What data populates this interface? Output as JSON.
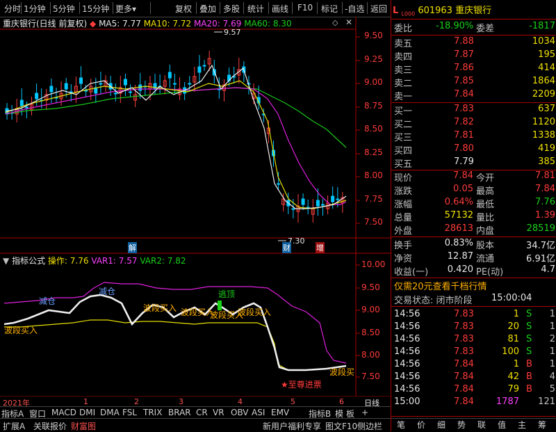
{
  "toolbar": {
    "items": [
      "分时",
      "1分钟",
      "5分钟",
      "15分钟",
      "更多",
      "复权",
      "叠加",
      "多股",
      "统计",
      "画线",
      "F10",
      "标记",
      "-自选",
      "返回"
    ]
  },
  "chart_header": {
    "title": "重庆银行(日线 前复权)",
    "ma5_label": "MA5: 7.77",
    "ma10_label": "MA10: 7.72",
    "ma20_label": "MA20: 7.69",
    "ma60_label": "MA60: 8.30"
  },
  "price_axis": [
    "9.50",
    "9.25",
    "9.00",
    "8.75",
    "8.50",
    "8.25",
    "8.00",
    "7.75",
    "7.50"
  ],
  "price_annotations": {
    "high": "9.57",
    "low": "7.30"
  },
  "markers": {
    "jie": "解",
    "cai": "财",
    "zeng": "增"
  },
  "indicator_header": {
    "title": "指标公式",
    "op_label": "操作: 7.76",
    "var1_label": "VAR1: 7.57",
    "var2_label": "VAR2: 7.82"
  },
  "ind_axis": [
    "10.00",
    "9.50",
    "9.00",
    "8.50",
    "8.00",
    "7.50"
  ],
  "ind_labels": {
    "jiancang1": "减仓",
    "jiancang2": "减仓",
    "taoding": "逃顶",
    "buy1": "波段买入",
    "buy2": "波段买入",
    "buy3": "波段买入",
    "buy4": "波段买入",
    "buy5": "波段买入",
    "buy6": "波段买",
    "zhizun": "★至尊进票"
  },
  "time_axis": {
    "year": "2021年",
    "months": [
      "1",
      "2",
      "3",
      "4",
      "5",
      "6"
    ],
    "right_label": "日线"
  },
  "indicator_tabs": [
    "指标A",
    "窗口",
    "MACD",
    "DMI",
    "DMA",
    "FSL",
    "TRIX",
    "BRAR",
    "CR",
    "VR",
    "OBV",
    "ASI",
    "EMV",
    "指标B",
    "模",
    "板",
    "+"
  ],
  "bottom_tabs": [
    "扩展A",
    "关联报价",
    "财富图"
  ],
  "bottom_right_links": [
    "新用户福利专享",
    "图文F10",
    "侧边栏"
  ],
  "right_panel": {
    "l_badge": "L",
    "level_badge": "L000",
    "code": "601963",
    "name": "重庆银行",
    "weibi_label": "委比",
    "weibi_value": "-18.90%",
    "weicha_label": "委差",
    "weicha_value": "-1817",
    "asks": [
      {
        "label": "卖五",
        "price": "7.88",
        "vol": "1034"
      },
      {
        "label": "卖四",
        "price": "7.87",
        "vol": "195"
      },
      {
        "label": "卖三",
        "price": "7.86",
        "vol": "414"
      },
      {
        "label": "卖二",
        "price": "7.85",
        "vol": "1864"
      },
      {
        "label": "卖一",
        "price": "7.84",
        "vol": "2209"
      }
    ],
    "bids": [
      {
        "label": "买一",
        "price": "7.83",
        "vol": "637"
      },
      {
        "label": "买二",
        "price": "7.82",
        "vol": "1120"
      },
      {
        "label": "买三",
        "price": "7.81",
        "vol": "1338"
      },
      {
        "label": "买四",
        "price": "7.80",
        "vol": "419"
      },
      {
        "label": "买五",
        "price": "7.79",
        "vol": "385"
      }
    ],
    "stats": [
      {
        "l1": "现价",
        "v1": "7.84",
        "l2": "今开",
        "v2": "7.81"
      },
      {
        "l1": "涨跌",
        "v1": "0.05",
        "l2": "最高",
        "v2": "7.84"
      },
      {
        "l1": "涨幅",
        "v1": "0.64%",
        "l2": "最低",
        "v2": "7.76"
      },
      {
        "l1": "总量",
        "v1": "57132",
        "l2": "量比",
        "v2": "1.39"
      },
      {
        "l1": "外盘",
        "v1": "28613",
        "l2": "内盘",
        "v2": "28519"
      }
    ],
    "stats2": [
      {
        "l1": "换手",
        "v1": "0.83%",
        "l2": "股本",
        "v2": "34.7亿"
      },
      {
        "l1": "净资",
        "v1": "12.87",
        "l2": "流通",
        "v2": "6.91亿"
      },
      {
        "l1": "收益(一)",
        "v1": "0.420",
        "l2": "PE(动)",
        "v2": "4.7"
      }
    ],
    "promo": "仅需20元查看千档行情",
    "status_label": "交易状态: 闭市阶段",
    "status_time": "15:00:04",
    "ticks": [
      {
        "t": "14:56",
        "p": "7.83",
        "v": "1",
        "s": "S",
        "n": "1"
      },
      {
        "t": "14:56",
        "p": "7.83",
        "v": "20",
        "s": "S",
        "n": "1"
      },
      {
        "t": "14:56",
        "p": "7.83",
        "v": "81",
        "s": "S",
        "n": "2"
      },
      {
        "t": "14:56",
        "p": "7.83",
        "v": "100",
        "s": "S",
        "n": "1"
      },
      {
        "t": "14:56",
        "p": "7.84",
        "v": "1",
        "s": "B",
        "n": "1"
      },
      {
        "t": "14:56",
        "p": "7.84",
        "v": "42",
        "s": "B",
        "n": "4"
      },
      {
        "t": "14:56",
        "p": "7.84",
        "v": "79",
        "s": "B",
        "n": "5"
      },
      {
        "t": "15:00",
        "p": "7.84",
        "v": "1787",
        "s": "",
        "n": "121"
      }
    ],
    "bottom_buttons": [
      "笔",
      "价",
      "细",
      "势",
      "联",
      "值",
      "主",
      "筹"
    ]
  }
}
